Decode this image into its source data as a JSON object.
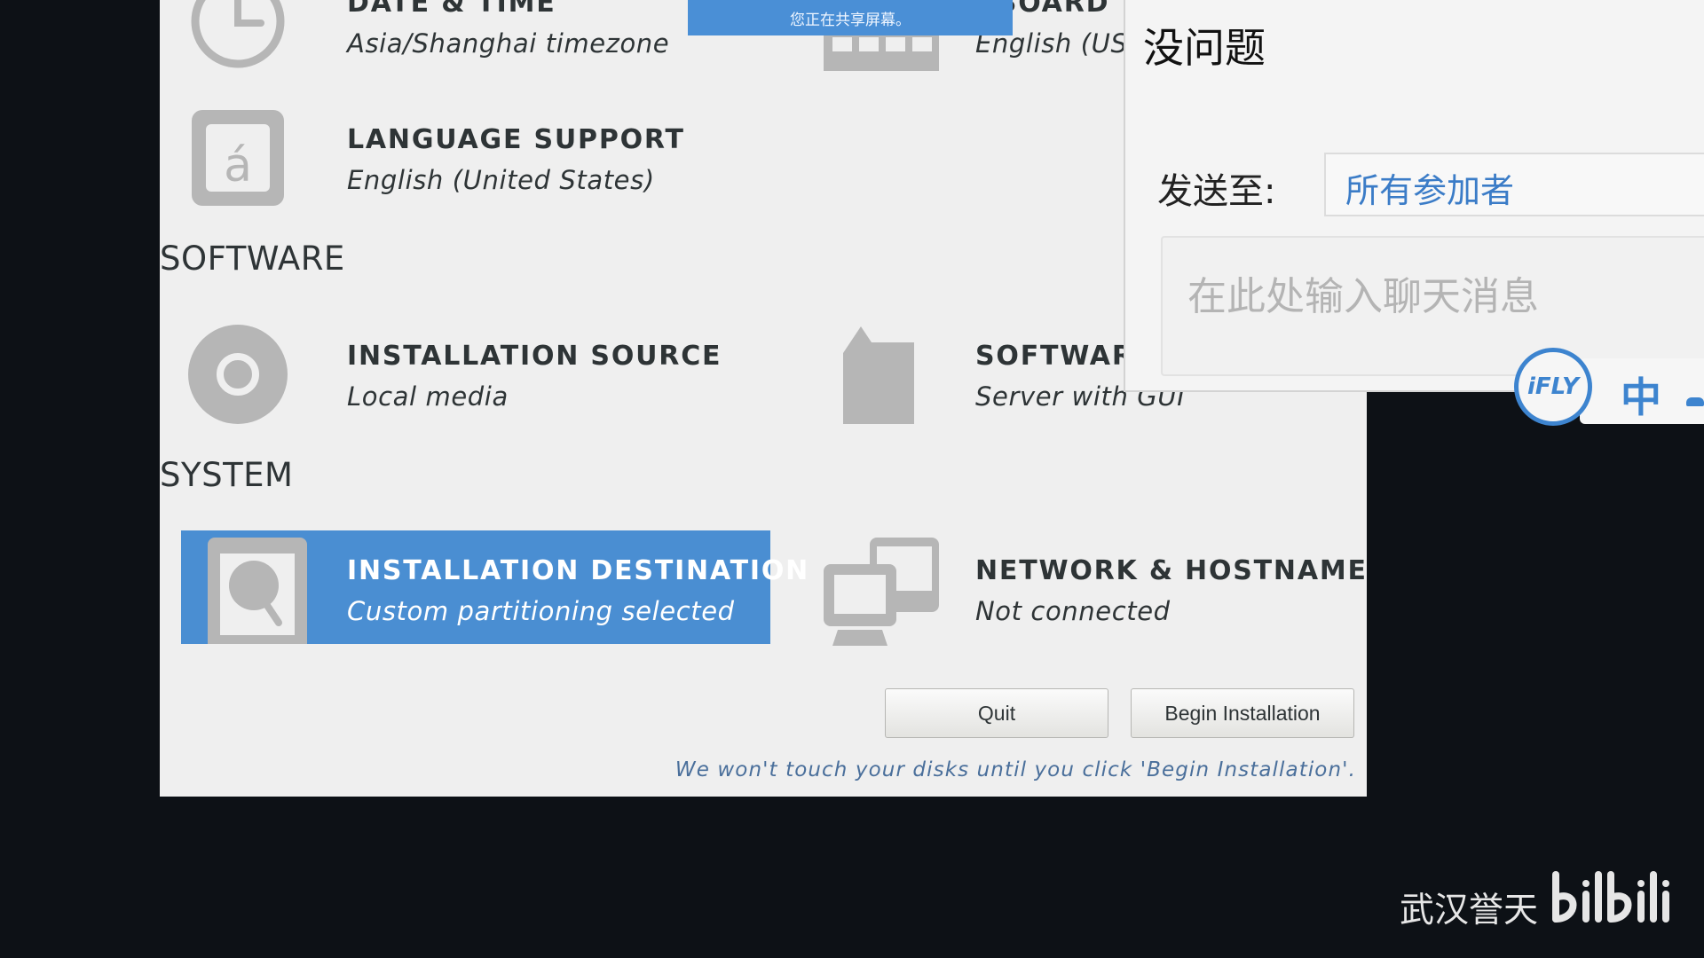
{
  "installer": {
    "localization": {
      "date_time": {
        "title": "DATE & TIME",
        "status": "Asia/Shanghai timezone"
      },
      "keyboard": {
        "title": "YBOARD",
        "status": "English (US)"
      },
      "language_support": {
        "title": "LANGUAGE SUPPORT",
        "status": "English (United States)"
      }
    },
    "software": {
      "heading": "SOFTWARE",
      "installation_source": {
        "title": "INSTALLATION SOURCE",
        "status": "Local media"
      },
      "software_selection": {
        "title": "SOFTWARE",
        "status": "Server with GUI"
      }
    },
    "system": {
      "heading": "SYSTEM",
      "installation_destination": {
        "title": "INSTALLATION DESTINATION",
        "status": "Custom partitioning selected"
      },
      "network_hostname": {
        "title": "NETWORK & HOSTNAME",
        "status": "Not connected"
      }
    },
    "buttons": {
      "quit": "Quit",
      "begin": "Begin Installation"
    },
    "footer_note": "We won't touch your disks until you click 'Begin Installation'.",
    "accent_color": "#4a8ed2",
    "icons": {
      "date_time": "clock-icon",
      "keyboard": "keyboard-icon",
      "language_support": "language-icon",
      "installation_source": "disc-icon",
      "software_selection": "package-icon",
      "installation_destination": "hard-drive-icon",
      "network_hostname": "network-icon"
    }
  },
  "share_banner": "您正在共享屏幕。",
  "chat": {
    "title": "没问题",
    "send_to_label": "发送至:",
    "recipient": "所有参加者",
    "input_placeholder": "在此处输入聊天消息"
  },
  "ime": {
    "logo": "iFLY",
    "mode": "中"
  },
  "watermark": {
    "author": "武汉誉天",
    "logo_name": "bilibili-logo"
  }
}
